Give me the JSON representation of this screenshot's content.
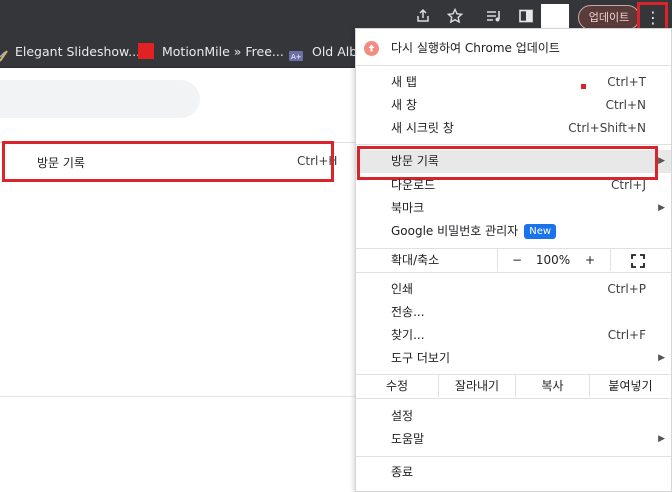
{
  "toolbar": {
    "update_label": "업데이트",
    "icons": [
      "share-icon",
      "star-icon",
      "media-control-icon",
      "side-panel-icon",
      "profile-avatar",
      "kebab-menu-icon"
    ]
  },
  "bookmarks": {
    "items": [
      {
        "label": "Elegant Slideshow..."
      },
      {
        "label": "MotionMile » Free..."
      },
      {
        "label": "Old Alb"
      }
    ]
  },
  "left_panel": {
    "history_label": "방문 기록",
    "history_shortcut": "Ctrl+H"
  },
  "menu": {
    "update_item": "다시 실행하여 Chrome 업데이트",
    "new_tab": {
      "label": "새 탭",
      "shortcut": "Ctrl+T"
    },
    "new_window": {
      "label": "새 창",
      "shortcut": "Ctrl+N"
    },
    "incognito": {
      "label": "새 시크릿 창",
      "shortcut": "Ctrl+Shift+N"
    },
    "history": {
      "label": "방문 기록"
    },
    "downloads": {
      "label": "다운로드",
      "shortcut": "Ctrl+J"
    },
    "bookmarks": {
      "label": "북마크"
    },
    "password_manager": {
      "label": "Google 비밀번호 관리자",
      "badge": "New"
    },
    "zoom": {
      "label": "확대/축소",
      "minus": "−",
      "value": "100%",
      "plus": "+"
    },
    "print": {
      "label": "인쇄",
      "shortcut": "Ctrl+P"
    },
    "cast": {
      "label": "전송..."
    },
    "find": {
      "label": "찾기...",
      "shortcut": "Ctrl+F"
    },
    "more_tools": {
      "label": "도구 더보기"
    },
    "edit": {
      "label": "수정",
      "cut": "잘라내기",
      "copy": "복사",
      "paste": "붙여넣기"
    },
    "settings": {
      "label": "설정"
    },
    "help": {
      "label": "도움말"
    },
    "exit": {
      "label": "종료"
    }
  },
  "colors": {
    "highlight": "#d8252b",
    "toolbar_bg": "#35363a",
    "hover_bg": "#e8e8e9",
    "badge": "#1a73e8"
  }
}
